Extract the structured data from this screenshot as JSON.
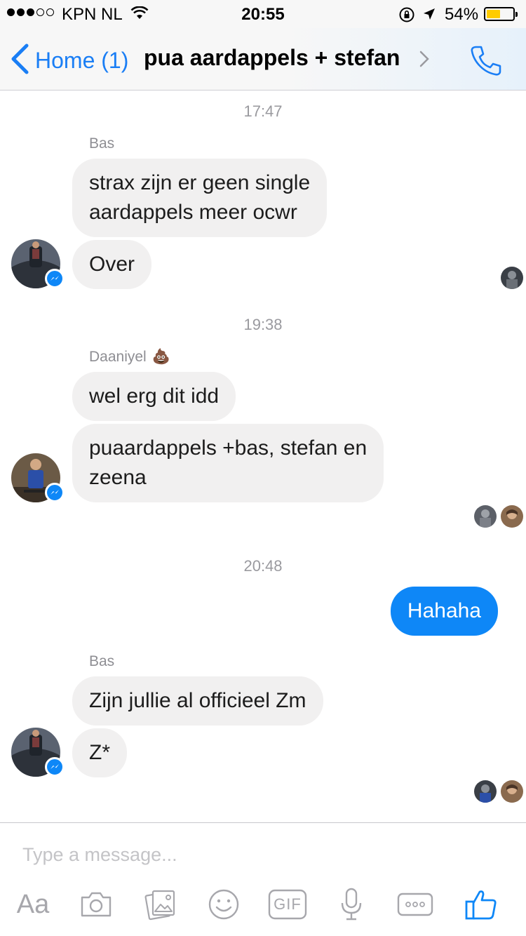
{
  "status_bar": {
    "carrier": "KPN NL",
    "time": "20:55",
    "battery_percent": "54%",
    "battery_level": 0.54,
    "signal_bars": 3
  },
  "nav": {
    "back_label": "Home (1)",
    "title": "pua aardappels + stefan"
  },
  "conversation": {
    "timestamps": [
      "17:47",
      "19:38",
      "20:48"
    ],
    "group1": {
      "sender": "Bas",
      "messages": [
        "strax zijn er geen single\naardappels meer ocwr",
        "Over"
      ]
    },
    "group2": {
      "sender": "Daaniyel",
      "sender_emoji": "💩",
      "messages": [
        "wel erg dit idd",
        "puaardappels  +bas, stefan en\nzeena"
      ]
    },
    "outgoing": {
      "messages": [
        "Hahaha"
      ]
    },
    "group3": {
      "sender": "Bas",
      "messages": [
        "Zijn jullie al officieel Zm",
        "Z*"
      ]
    }
  },
  "composer": {
    "placeholder": "Type a message...",
    "aa_label": "Aa",
    "gif_label": "GIF"
  },
  "colors": {
    "accent": "#0e87f7",
    "incoming_bubble": "#f1f0f0",
    "muted": "#8e8e93"
  }
}
